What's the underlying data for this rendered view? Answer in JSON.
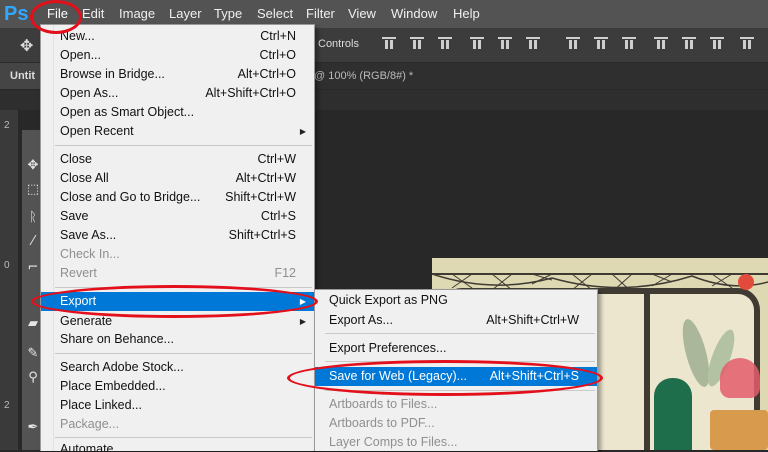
{
  "app": {
    "logo": "Ps"
  },
  "menubar": {
    "items": [
      "File",
      "Edit",
      "Image",
      "Layer",
      "Type",
      "Select",
      "Filter",
      "View",
      "Window",
      "Help"
    ]
  },
  "optionsbar": {
    "controls_label": "Controls"
  },
  "tabs": {
    "first": "Untit",
    "second": "@ 100% (RGB/8#) *"
  },
  "rulers": {
    "marks": [
      "2",
      "0",
      "2"
    ]
  },
  "file_menu": {
    "new": {
      "label": "New...",
      "shortcut": "Ctrl+N"
    },
    "open": {
      "label": "Open...",
      "shortcut": "Ctrl+O"
    },
    "browse": {
      "label": "Browse in Bridge...",
      "shortcut": "Alt+Ctrl+O"
    },
    "open_as": {
      "label": "Open As...",
      "shortcut": "Alt+Shift+Ctrl+O"
    },
    "open_smart": {
      "label": "Open as Smart Object..."
    },
    "open_recent": {
      "label": "Open Recent"
    },
    "close": {
      "label": "Close",
      "shortcut": "Ctrl+W"
    },
    "close_all": {
      "label": "Close All",
      "shortcut": "Alt+Ctrl+W"
    },
    "close_bridge": {
      "label": "Close and Go to Bridge...",
      "shortcut": "Shift+Ctrl+W"
    },
    "save": {
      "label": "Save",
      "shortcut": "Ctrl+S"
    },
    "save_as": {
      "label": "Save As...",
      "shortcut": "Shift+Ctrl+S"
    },
    "check_in": {
      "label": "Check In..."
    },
    "revert": {
      "label": "Revert",
      "shortcut": "F12"
    },
    "export": {
      "label": "Export"
    },
    "generate": {
      "label": "Generate"
    },
    "share_behance": {
      "label": "Share on Behance..."
    },
    "search_stock": {
      "label": "Search Adobe Stock..."
    },
    "place_embedded": {
      "label": "Place Embedded..."
    },
    "place_linked": {
      "label": "Place Linked..."
    },
    "package": {
      "label": "Package..."
    },
    "automate": {
      "label": "Automate"
    }
  },
  "export_menu": {
    "quick_export": {
      "label": "Quick Export as PNG"
    },
    "export_as": {
      "label": "Export As...",
      "shortcut": "Alt+Shift+Ctrl+W"
    },
    "export_prefs": {
      "label": "Export Preferences..."
    },
    "save_web": {
      "label": "Save for Web (Legacy)...",
      "shortcut": "Alt+Shift+Ctrl+S"
    },
    "artboards_files": {
      "label": "Artboards to Files..."
    },
    "artboards_pdf": {
      "label": "Artboards to PDF..."
    },
    "layer_comps": {
      "label": "Layer Comps to Files..."
    }
  },
  "colors": {
    "highlight": "#0078d7",
    "annotation": "#e3101b",
    "menubar": "#535353",
    "menu_bg": "#f0f0f0"
  }
}
